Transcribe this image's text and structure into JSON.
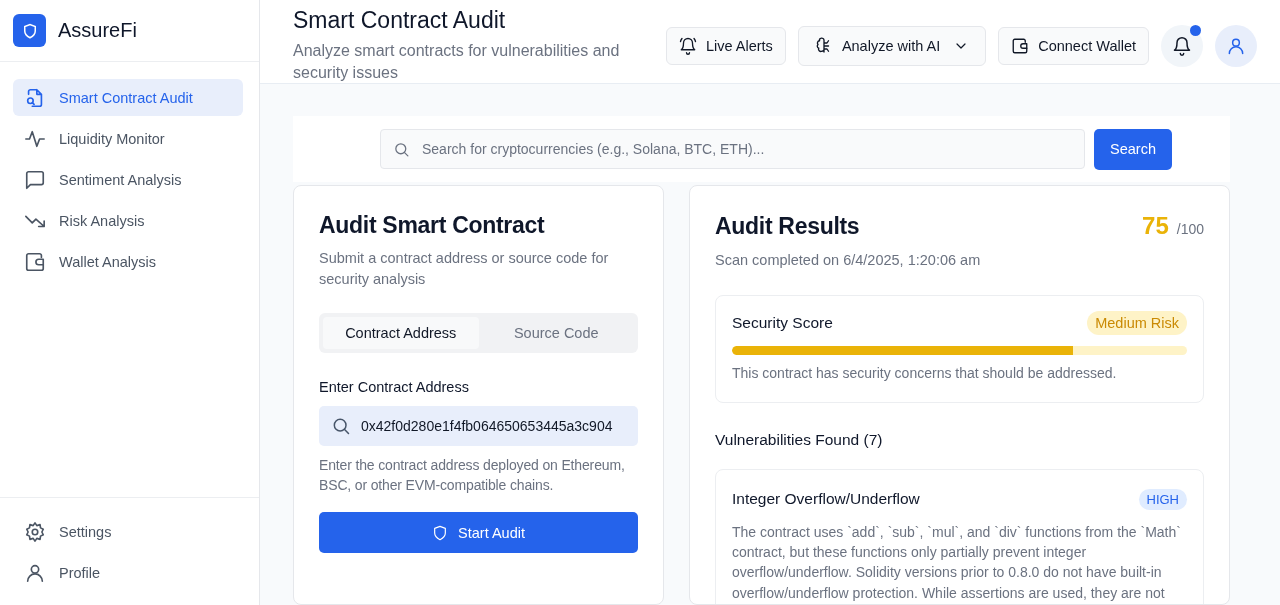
{
  "brand": {
    "name": "AssureFi"
  },
  "sidebar": {
    "items": [
      {
        "label": "Smart Contract Audit",
        "selected": true
      },
      {
        "label": "Liquidity Monitor",
        "selected": false
      },
      {
        "label": "Sentiment Analysis",
        "selected": false
      },
      {
        "label": "Risk Analysis",
        "selected": false
      },
      {
        "label": "Wallet Analysis",
        "selected": false
      }
    ],
    "footer_items": [
      {
        "label": "Settings",
        "selected": false
      },
      {
        "label": "Profile",
        "selected": false
      }
    ]
  },
  "header": {
    "title": "Smart Contract Audit",
    "subtitle": "Analyze smart contracts for vulnerabilities and security issues",
    "buttons": [
      {
        "label": "Live Alerts",
        "kind": "button"
      },
      {
        "label": "Analyze with AI",
        "kind": "dropdown"
      },
      {
        "label": "Connect Wallet",
        "kind": "button"
      }
    ],
    "notifications": {
      "unread": true
    }
  },
  "search": {
    "placeholder": "Search for cryptocurrencies (e.g., Solana, BTC, ETH)...",
    "button": "Search"
  },
  "audit_form": {
    "title": "Audit Smart Contract",
    "subtitle": "Submit a contract address or source code for security analysis",
    "tabs": [
      {
        "label": "Contract Address",
        "selected": true
      },
      {
        "label": "Source Code",
        "selected": false
      }
    ],
    "field_label": "Enter Contract Address",
    "field_value": "0x42f0d280e1f4fb064650653445a3c904",
    "hint": "Enter the contract address deployed on Ethereum, BSC, or other EVM-compatible chains.",
    "button": "Start Audit"
  },
  "results": {
    "title": "Audit Results",
    "score": "75",
    "score_max": "/100",
    "scan_time": "Scan completed on 6/4/2025, 1:20:06 am",
    "security": {
      "title": "Security Score",
      "risk": "Medium Risk",
      "level": 0.75,
      "note": "This contract has security concerns that should be addressed."
    },
    "vulnerabilities_title": "Vulnerabilities Found (7)",
    "vulnerabilities": [
      {
        "title": "Integer Overflow/Underflow",
        "severity": "HIGH",
        "description": "The contract uses `add`, `sub`, `mul`, and `div` functions from the `Math` contract, but these functions only partially prevent integer overflow/underflow. Solidity versions prior to 0.8.0 do not have built-in overflow/underflow protection. While assertions are used, they are not"
      }
    ]
  }
}
